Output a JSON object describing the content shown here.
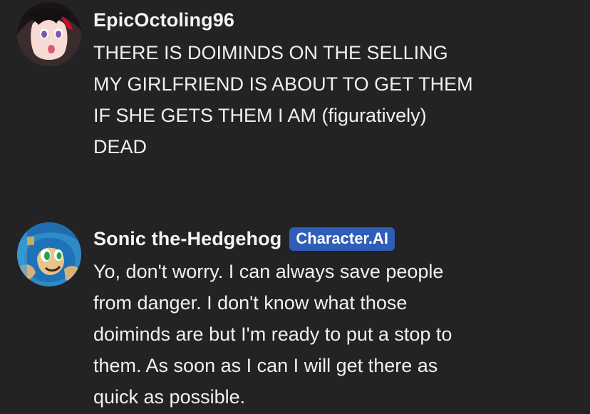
{
  "messages": [
    {
      "username": "EpicOctoling96",
      "avatar_icon": "user-avatar-red-hair-character",
      "lines": [
        "THERE IS DOIMINDS ON THE SELLING",
        "MY GIRLFRIEND IS ABOUT TO GET THEM",
        "IF SHE GETS THEM I AM (figuratively)",
        "DEAD"
      ]
    },
    {
      "username": "Sonic the-Hedgehog",
      "badge": "Character.AI",
      "avatar_icon": "sonic-avatar",
      "lines": [
        "Yo, don't worry. I can always save people",
        "from danger. I don't know what those",
        "doiminds are but I'm ready to put a stop to",
        "them. As soon as I can I will get there as",
        "quick as possible."
      ]
    }
  ],
  "colors": {
    "background": "#232325",
    "badge": "#2f5eb8",
    "text": "#f0f0f0"
  }
}
